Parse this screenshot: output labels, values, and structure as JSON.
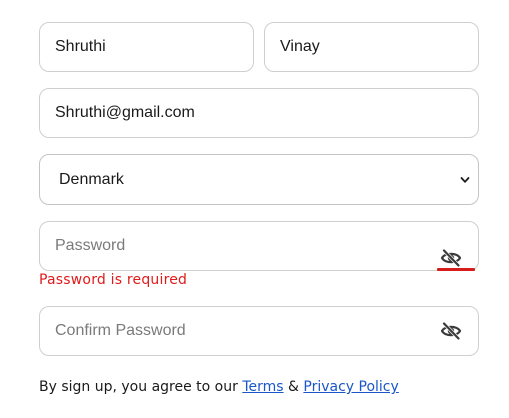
{
  "form": {
    "first_name": {
      "value": "Shruthi"
    },
    "last_name": {
      "value": "Vinay"
    },
    "email": {
      "value": "Shruthi@gmail.com"
    },
    "country": {
      "selected": "Denmark"
    },
    "password": {
      "placeholder": "Password",
      "error": "Password is required",
      "toggle_icon": "eye-slash-icon"
    },
    "confirm_password": {
      "placeholder": "Confirm Password",
      "toggle_icon": "eye-slash-icon"
    },
    "terms": {
      "prefix": "By sign up, you agree to our",
      "terms_link": "Terms",
      "separator": "&",
      "privacy_link": "Privacy Policy"
    }
  },
  "colors": {
    "error": "#e01b1b",
    "link": "#1a56c9",
    "border": "#cfcfcf"
  }
}
